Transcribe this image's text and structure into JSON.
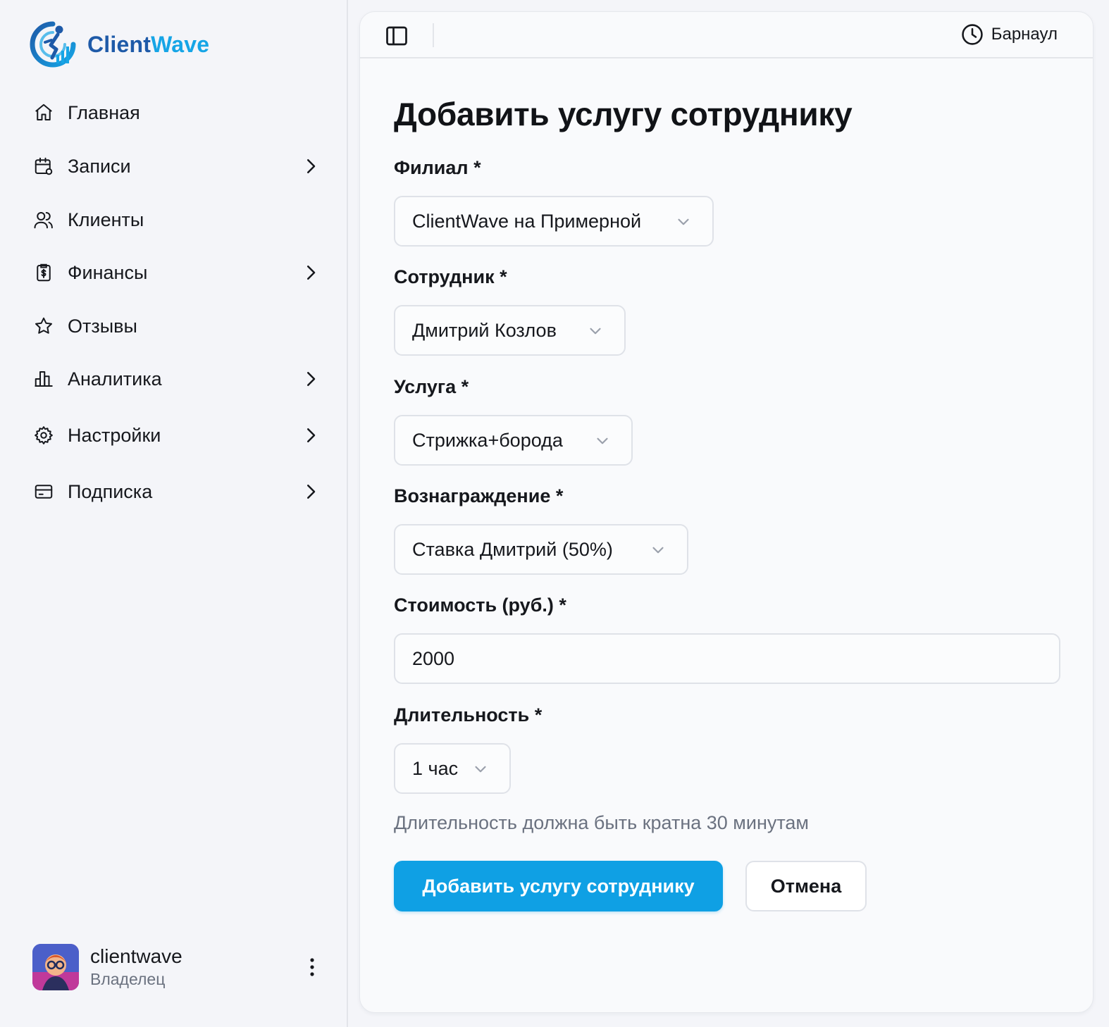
{
  "brand": {
    "name_part1": "Client",
    "name_part2": "Wave"
  },
  "sidebar": {
    "items": [
      {
        "label": "Главная",
        "icon": "home-icon",
        "has_submenu": false
      },
      {
        "label": "Записи",
        "icon": "calendar-icon",
        "has_submenu": true
      },
      {
        "label": "Клиенты",
        "icon": "users-icon",
        "has_submenu": false
      },
      {
        "label": "Финансы",
        "icon": "receipt-icon",
        "has_submenu": true
      },
      {
        "label": "Отзывы",
        "icon": "star-icon",
        "has_submenu": false
      },
      {
        "label": "Аналитика",
        "icon": "chart-icon",
        "has_submenu": true
      },
      {
        "label": "Настройки",
        "icon": "gear-icon",
        "has_submenu": true
      },
      {
        "label": "Подписка",
        "icon": "card-icon",
        "has_submenu": true
      }
    ]
  },
  "user": {
    "name": "clientwave",
    "role": "Владелец"
  },
  "topbar": {
    "timezone": "Барнаул"
  },
  "form": {
    "title": "Добавить услугу сотруднику",
    "branch": {
      "label": "Филиал *",
      "value": "ClientWave на Примерной"
    },
    "employee": {
      "label": "Сотрудник *",
      "value": "Дмитрий Козлов"
    },
    "service": {
      "label": "Услуга *",
      "value": "Стрижка+борода"
    },
    "reward": {
      "label": "Вознаграждение *",
      "value": "Ставка Дмитрий (50%)"
    },
    "price": {
      "label": "Стоимость (руб.) *",
      "value": "2000"
    },
    "duration": {
      "label": "Длительность *",
      "value": "1 час",
      "hint": "Длительность должна быть кратна 30 минутам"
    },
    "submit_label": "Добавить услугу сотруднику",
    "cancel_label": "Отмена"
  },
  "colors": {
    "accent": "#0fa0e4",
    "brand_dark": "#1e5aa8",
    "brand_light": "#16a5e6",
    "background": "#f4f5f9"
  }
}
